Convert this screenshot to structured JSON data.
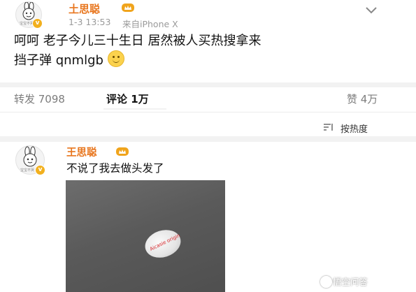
{
  "post": {
    "avatar_caption": "宝宝不哭",
    "username": "土思聪",
    "time": "1-3 13:53",
    "source": "来自iPhone X",
    "content_line1": "呵呵 老子今儿三十生日 居然被人买热搜拿来",
    "content_line2": "挡子弹 qnmlgb",
    "emoji": "smile-emoji"
  },
  "stats": {
    "repost": "转发 7098",
    "comment": "评论 1万",
    "like": "赞 4万"
  },
  "sort": {
    "label": "按热度"
  },
  "comment": {
    "avatar_caption": "宝宝不哭",
    "username": "王思聪",
    "text": "不说了我去做头发了",
    "photo_text": "Aicasie origin"
  },
  "watermark": {
    "text": "悟空问答"
  },
  "colors": {
    "username": "#e8761e",
    "badge": "#f2b01e",
    "meta": "#9a9a9a"
  }
}
